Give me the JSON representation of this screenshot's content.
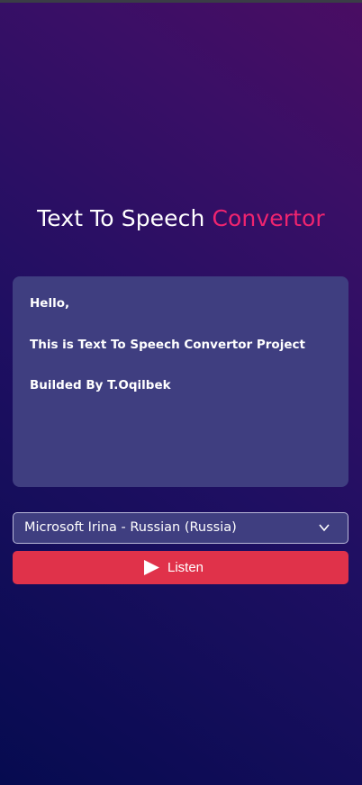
{
  "header": {
    "title_main": "Text To Speech ",
    "title_accent": "Convertor"
  },
  "textarea": {
    "lines": [
      "Hello,",
      "This is Text To Speech Convertor Project",
      "Builded By T.Oqilbek"
    ]
  },
  "voice_select": {
    "selected": "Microsoft Irina - Russian (Russia)",
    "icon": "chevron-down-icon"
  },
  "listen_button": {
    "label": "Listen",
    "icon": "play-icon"
  },
  "colors": {
    "accent": "#f0246f",
    "button": "#e0324a",
    "panel": "#3f3e80"
  }
}
